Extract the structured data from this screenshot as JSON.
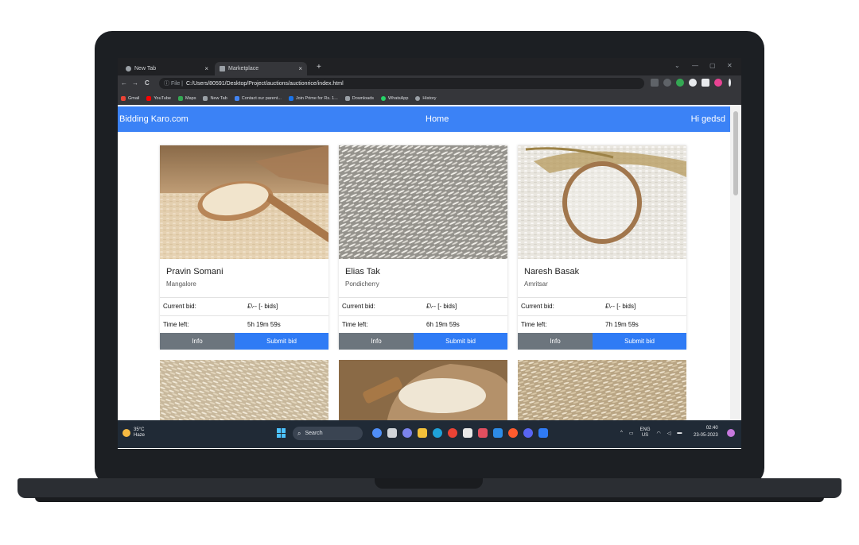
{
  "browser": {
    "tabs": [
      {
        "label": "New Tab",
        "close": "×"
      },
      {
        "label": "Marketplace",
        "close": "×"
      }
    ],
    "new_tab": "+",
    "window_controls": [
      "⌄",
      "—",
      "▢",
      "✕"
    ],
    "nav": {
      "back": "←",
      "forward": "→",
      "reload": "C"
    },
    "address": {
      "scheme": "ⓘ File |",
      "url": "C:/Users/80591/Desktop/Project/auctions/auctionrice/index.html"
    },
    "bookmarks": [
      {
        "label": "Gmail",
        "color": "#ea4335"
      },
      {
        "label": "YouTube",
        "color": "#ff0000"
      },
      {
        "label": "Maps",
        "color": "#34a853"
      },
      {
        "label": "New Tab",
        "color": "#9aa0a6"
      },
      {
        "label": "Contact our parent...",
        "color": "#4285f4"
      },
      {
        "label": "Join Prime for Rs. 1...",
        "color": "#1a73e8"
      },
      {
        "label": "Downloads",
        "color": "#9aa0a6"
      },
      {
        "label": "WhatsApp",
        "color": "#25d366"
      },
      {
        "label": "History",
        "color": "#9aa0a6"
      }
    ]
  },
  "navbar": {
    "brand": "Bidding Karo.com",
    "home": "Home",
    "greeting": "Hi gedsd"
  },
  "cards": [
    {
      "name": "Pravin Somani",
      "city": "Mangalore",
      "current_bid_label": "Current bid:",
      "current_bid_value": "£\\-- [- bids]",
      "time_label": "Time left:",
      "time_value": "5h 19m 59s",
      "info": "Info",
      "submit": "Submit bid"
    },
    {
      "name": "Elias Tak",
      "city": "Pondicherry",
      "current_bid_label": "Current bid:",
      "current_bid_value": "£\\-- [- bids]",
      "time_label": "Time left:",
      "time_value": "6h 19m 59s",
      "info": "Info",
      "submit": "Submit bid"
    },
    {
      "name": "Naresh Basak",
      "city": "Amritsar",
      "current_bid_label": "Current bid:",
      "current_bid_value": "£\\-- [- bids]",
      "time_label": "Time left:",
      "time_value": "7h 19m 59s",
      "info": "Info",
      "submit": "Submit bid"
    }
  ],
  "taskbar": {
    "temperature": "35°C",
    "weather": "Haze",
    "search": "Search",
    "lang": "ENG",
    "region": "US",
    "time": "02:40",
    "date": "23-05-2023"
  },
  "colors": {
    "navbar": "#3b82f6",
    "submit_button": "#2f7bf5",
    "info_button": "#6c757d"
  }
}
